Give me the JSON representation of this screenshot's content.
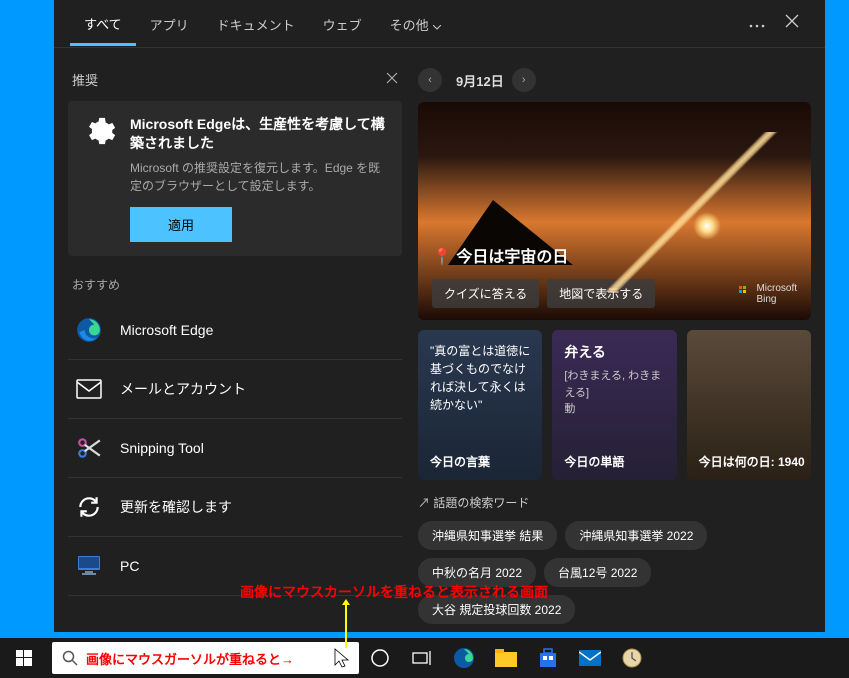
{
  "tabs": {
    "items": [
      "すべて",
      "アプリ",
      "ドキュメント",
      "ウェブ",
      "その他"
    ],
    "active_index": 0
  },
  "recommendation": {
    "section_title": "推奨",
    "heading": "Microsoft Edgeは、生産性を考慮して構築されました",
    "description": "Microsoft の推奨設定を復元します。Edge を既定のブラウザーとして設定します。",
    "button": "適用"
  },
  "osusume": {
    "title": "おすすめ",
    "items": [
      {
        "label": "Microsoft Edge",
        "icon": "edge-icon"
      },
      {
        "label": "メールとアカウント",
        "icon": "mail-icon"
      },
      {
        "label": "Snipping Tool",
        "icon": "snip-icon"
      },
      {
        "label": "更新を確認します",
        "icon": "refresh-icon"
      },
      {
        "label": "PC",
        "icon": "pc-icon"
      }
    ]
  },
  "date_nav": {
    "date": "9月12日"
  },
  "hero": {
    "title": "📍 今日は宇宙の日",
    "actions": [
      "クイズに答える",
      "地図で表示する"
    ],
    "brand": "Microsoft\nBing"
  },
  "cards": [
    {
      "type": "quote",
      "text": "\"真の富とは道徳に基づくものでなければ決して永くは続かない\"",
      "footer": "今日の言葉"
    },
    {
      "type": "word",
      "word": "弁える",
      "reading": "[わきまえる, わきまえる]",
      "pos": "動",
      "footer": "今日の単語"
    },
    {
      "type": "image",
      "footer": "今日は何の日: 1940"
    }
  ],
  "trending": {
    "title": "話題の検索ワード",
    "chips": [
      "沖縄県知事選挙 結果",
      "沖縄県知事選挙 2022",
      "中秋の名月 2022",
      "台風12号 2022",
      "大谷 規定投球回数 2022"
    ]
  },
  "annotation": {
    "hover_text": "画像にマウスカーソルを重ねると表示される画面",
    "searchbox_text": "画像にマウスガーソルが重ねると→"
  }
}
